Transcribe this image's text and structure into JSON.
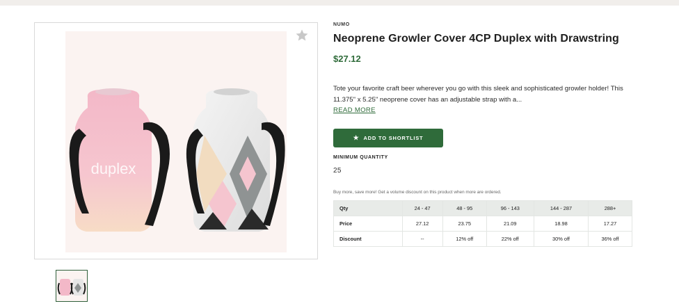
{
  "product": {
    "brand": "NUMO",
    "title": "Neoprene Growler Cover 4CP Duplex with Drawstring",
    "price": "$27.12",
    "description": "Tote your favorite craft beer wherever you go with this sleek and sophisticated growler holder! This 11.375\" x 5.25\" neoprene cover has an adjustable strap with a...",
    "read_more_label": "READ MORE",
    "shortlist_label": "ADD TO SHORTLIST",
    "min_quantity_label": "MINIMUM QUANTITY",
    "min_quantity_value": "25",
    "photo_print": "duplex"
  },
  "pricing": {
    "note": "Buy more, save more! Get a volume discount on this product when more are ordered.",
    "headers": [
      "Qty",
      "24 - 47",
      "48 - 95",
      "96 - 143",
      "144 - 287",
      "288+"
    ],
    "rows": [
      [
        "Price",
        "27.12",
        "23.75",
        "21.09",
        "18.98",
        "17.27"
      ],
      [
        "Discount",
        "--",
        "12% off",
        "22% off",
        "30% off",
        "36% off"
      ]
    ]
  },
  "icons": {
    "favorite": "star-icon",
    "button": "star-icon"
  },
  "colors": {
    "accent": "#2f6b3a",
    "photo_bg": "#fbf3f1",
    "table_header": "#e8ebe8"
  }
}
